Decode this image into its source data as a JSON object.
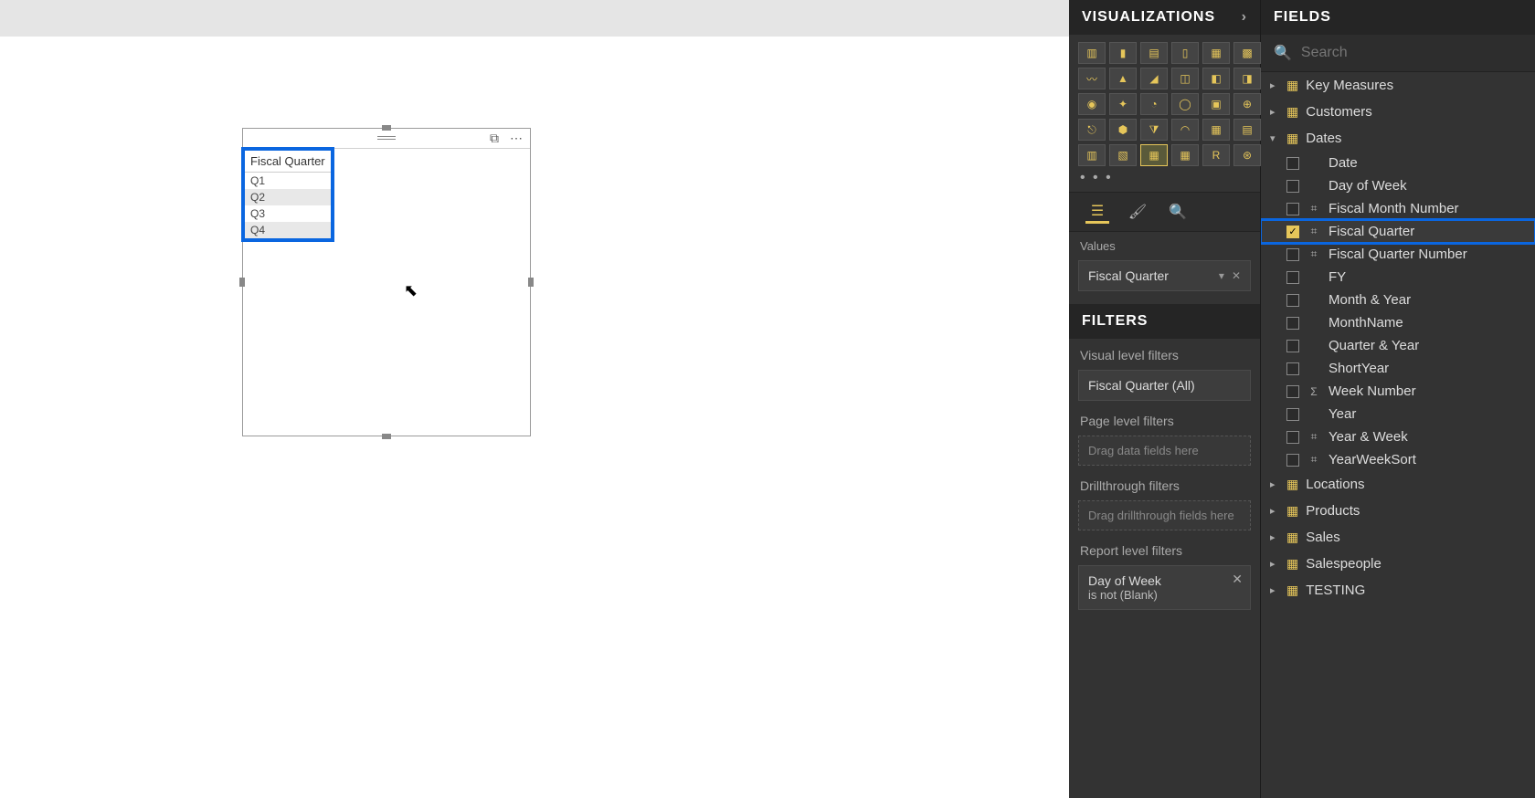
{
  "visual": {
    "header_col": "Fiscal Quarter",
    "rows": [
      "Q1",
      "Q2",
      "Q3",
      "Q4"
    ]
  },
  "viz_pane": {
    "title": "VISUALIZATIONS",
    "more": "• • •",
    "tab1": "☰",
    "values_label": "Values",
    "values_field": "Fiscal Quarter",
    "filters_title": "FILTERS",
    "visual_filters_label": "Visual level filters",
    "visual_filter_value": "Fiscal Quarter (All)",
    "page_filters_label": "Page level filters",
    "page_filters_placeholder": "Drag data fields here",
    "drill_filters_label": "Drillthrough filters",
    "drill_filters_placeholder": "Drag drillthrough fields here",
    "report_filters_label": "Report level filters",
    "report_filter_name": "Day of Week",
    "report_filter_cond": "is not (Blank)"
  },
  "fields_pane": {
    "title": "FIELDS",
    "search_placeholder": "Search",
    "tables": [
      {
        "name": "Key Measures",
        "expanded": false
      },
      {
        "name": "Customers",
        "expanded": false
      },
      {
        "name": "Dates",
        "expanded": true,
        "fields": [
          {
            "name": "Date",
            "type": "",
            "checked": false,
            "hl": false
          },
          {
            "name": "Day of Week",
            "type": "",
            "checked": false,
            "hl": false
          },
          {
            "name": "Fiscal Month Number",
            "type": "hier",
            "checked": false,
            "hl": false
          },
          {
            "name": "Fiscal Quarter",
            "type": "hier",
            "checked": true,
            "hl": true
          },
          {
            "name": "Fiscal Quarter Number",
            "type": "hier",
            "checked": false,
            "hl": false
          },
          {
            "name": "FY",
            "type": "",
            "checked": false,
            "hl": false
          },
          {
            "name": "Month & Year",
            "type": "",
            "checked": false,
            "hl": false
          },
          {
            "name": "MonthName",
            "type": "",
            "checked": false,
            "hl": false
          },
          {
            "name": "Quarter & Year",
            "type": "",
            "checked": false,
            "hl": false
          },
          {
            "name": "ShortYear",
            "type": "",
            "checked": false,
            "hl": false
          },
          {
            "name": "Week Number",
            "type": "sum",
            "checked": false,
            "hl": false
          },
          {
            "name": "Year",
            "type": "",
            "checked": false,
            "hl": false
          },
          {
            "name": "Year & Week",
            "type": "hier",
            "checked": false,
            "hl": false
          },
          {
            "name": "YearWeekSort",
            "type": "hier",
            "checked": false,
            "hl": false
          }
        ]
      },
      {
        "name": "Locations",
        "expanded": false
      },
      {
        "name": "Products",
        "expanded": false
      },
      {
        "name": "Sales",
        "expanded": false
      },
      {
        "name": "Salespeople",
        "expanded": false
      },
      {
        "name": "TESTING",
        "expanded": false
      }
    ]
  },
  "viz_icons": [
    "▥",
    "▮",
    "▤",
    "▯",
    "▦",
    "▩",
    "〰",
    "▲",
    "◢",
    "◫",
    "◧",
    "◨",
    "◉",
    "✦",
    "◔",
    "◯",
    "▣",
    "⊕",
    "⎋",
    "⬢",
    "⧩",
    "◠",
    "▦",
    "▤",
    "▥",
    "▧",
    "▦",
    "▦",
    "R",
    "⊛"
  ],
  "table_viz_index": 26
}
